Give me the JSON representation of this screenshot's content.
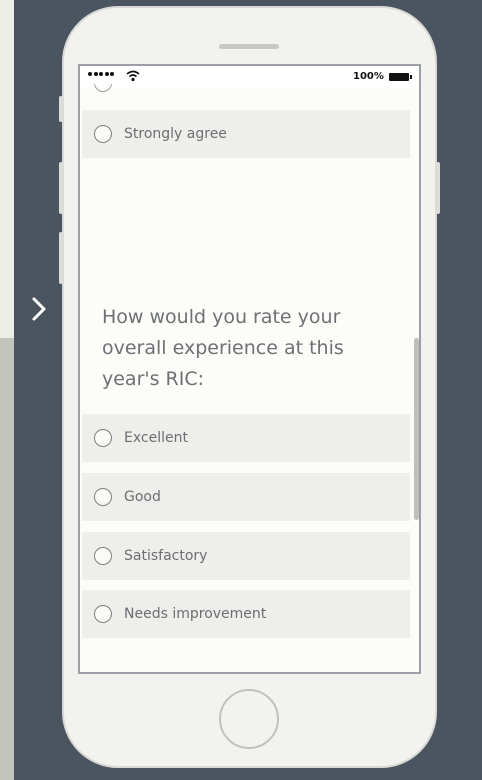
{
  "status_bar": {
    "battery": "100%"
  },
  "survey": {
    "prev_options": [
      {
        "label": "Strongly agree"
      }
    ],
    "question": "How would you rate your overall experience at this year's RIC:",
    "options": [
      {
        "label": "Excellent"
      },
      {
        "label": "Good"
      },
      {
        "label": "Satisfactory"
      },
      {
        "label": "Needs improvement"
      }
    ]
  },
  "icons": {
    "nav": "chevron-right-icon",
    "signal": "signal-dots-icon",
    "wifi": "wifi-icon",
    "battery": "battery-icon"
  },
  "colors": {
    "background": "#4b5560",
    "phone_body": "#f2f2ef",
    "option_bg": "#eeeeea",
    "text": "#6d7175"
  }
}
